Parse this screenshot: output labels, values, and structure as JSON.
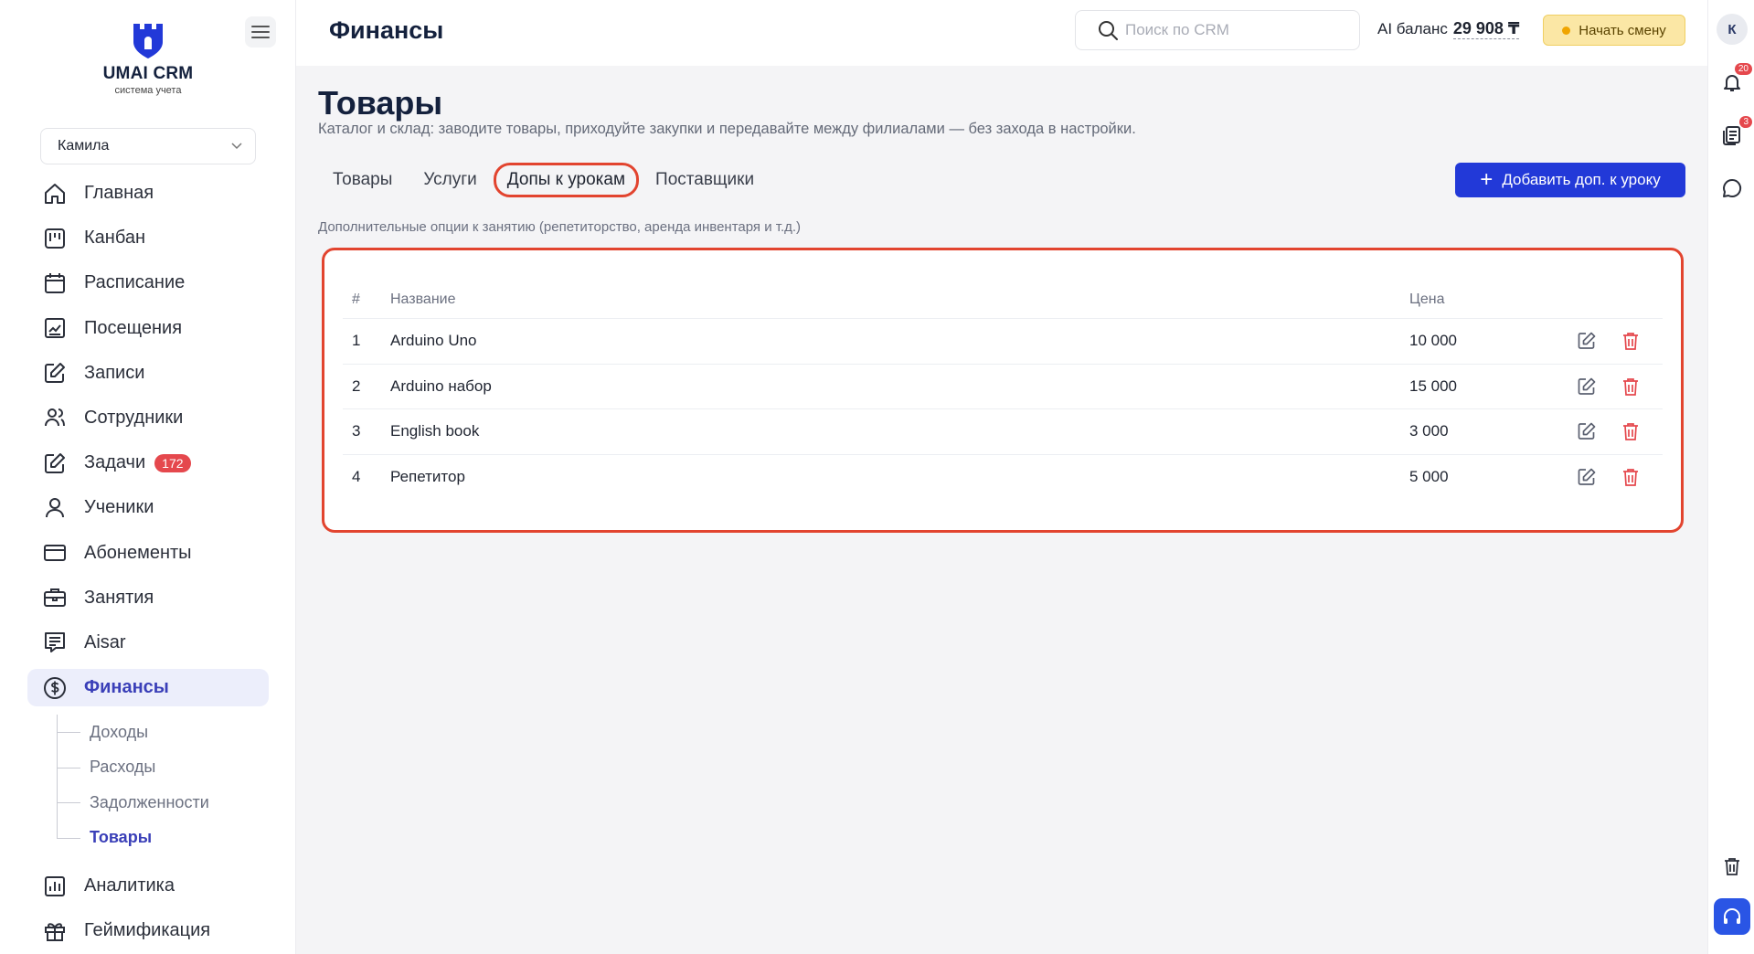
{
  "app": {
    "logo_title": "UMAI CRM",
    "logo_sub": "система учета",
    "user": "Камила"
  },
  "sidebar": {
    "items": [
      {
        "label": "Главная",
        "icon": "home-icon"
      },
      {
        "label": "Канбан",
        "icon": "kanban-icon"
      },
      {
        "label": "Расписание",
        "icon": "calendar-icon"
      },
      {
        "label": "Посещения",
        "icon": "chart-icon"
      },
      {
        "label": "Записи",
        "icon": "edit-icon"
      },
      {
        "label": "Сотрудники",
        "icon": "users-icon"
      },
      {
        "label": "Задачи",
        "icon": "tasks-icon",
        "badge": "172"
      },
      {
        "label": "Ученики",
        "icon": "user-icon"
      },
      {
        "label": "Абонементы",
        "icon": "card-icon"
      },
      {
        "label": "Занятия",
        "icon": "briefcase-icon"
      },
      {
        "label": "Aisar",
        "icon": "chat-lines-icon"
      },
      {
        "label": "Финансы",
        "icon": "dollar-icon",
        "active": true
      }
    ],
    "sub_items": [
      {
        "label": "Доходы"
      },
      {
        "label": "Расходы"
      },
      {
        "label": "Задолженности"
      },
      {
        "label": "Товары",
        "active": true
      }
    ],
    "items_bottom": [
      {
        "label": "Аналитика",
        "icon": "analytics-icon"
      },
      {
        "label": "Геймификация",
        "icon": "gift-icon"
      }
    ]
  },
  "header": {
    "title": "Финансы",
    "search_placeholder": "Поиск по CRM",
    "ai_label": "AI баланс",
    "ai_value": "29 908 ₸",
    "shift_button": "Начать смену",
    "avatar_letter": "К",
    "notifications_count": "20",
    "docs_count": "3"
  },
  "main": {
    "title": "Товары",
    "description": "Каталог и склад: заводите товары, приходуйте закупки и передавайте между филиалами — без захода в настройки.",
    "tabs": [
      {
        "label": "Товары"
      },
      {
        "label": "Услуги"
      },
      {
        "label": "Допы к урокам",
        "active": true
      },
      {
        "label": "Поставщики"
      }
    ],
    "add_button": "Добавить доп. к уроку",
    "hint": "Дополнительные опции к занятию (репетиторство, аренда инвентаря и т.д.)",
    "table": {
      "columns": {
        "num": "#",
        "name": "Название",
        "price": "Цена"
      },
      "rows": [
        {
          "num": "1",
          "name": "Arduino Uno",
          "price": "10 000"
        },
        {
          "num": "2",
          "name": "Arduino набор",
          "price": "15 000"
        },
        {
          "num": "3",
          "name": "English book",
          "price": "3 000"
        },
        {
          "num": "4",
          "name": "Репетитор",
          "price": "5 000"
        }
      ]
    }
  },
  "colors": {
    "accent": "#2239d8",
    "highlight": "#e2442f",
    "active_nav": "#3a3fb8",
    "badge": "#e5484d"
  }
}
